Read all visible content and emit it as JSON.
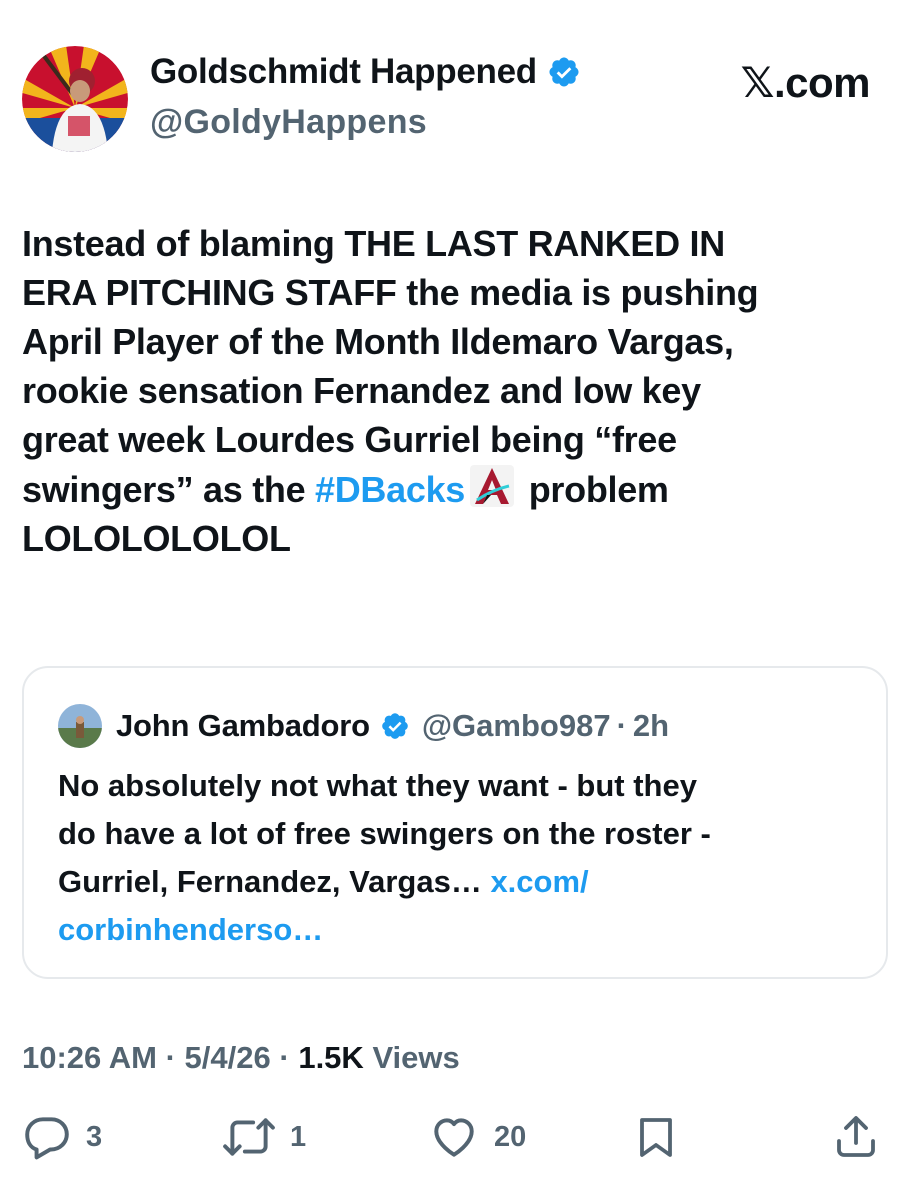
{
  "author": {
    "display_name": "Goldschmidt Happened",
    "handle": "@GoldyHappens",
    "verified": true
  },
  "brand": "𝕏.com",
  "tweet": {
    "lines": [
      "Instead of blaming THE LAST RANKED IN",
      "ERA PITCHING STAFF the media is pushing",
      "April Player of the Month Ildemaro Vargas,",
      "rookie sensation Fernandez and low key",
      "great week Lourdes Gurriel being “free"
    ],
    "line6_before": "swingers” as the ",
    "hashtag": "#DBacks",
    "line6_after": " problem",
    "line7": "LOLOLOLOLOL"
  },
  "quote": {
    "name": "John Gambadoro",
    "handle": "@Gambo987",
    "separator": "·",
    "time": "2h",
    "lines": [
      "No absolutely not what they want - but they",
      "do have a lot of free swingers on the roster -"
    ],
    "line3_text": "Gurriel, Fernandez, Vargas… ",
    "link_part1": "x.com/",
    "link_part2": "corbinhenderso…"
  },
  "meta": {
    "time": "10:26 AM",
    "sep": "·",
    "date": "5/4/26",
    "views_count": "1.5K",
    "views_label": "Views"
  },
  "actions": {
    "replies": "3",
    "reposts": "1",
    "likes": "20"
  },
  "colors": {
    "accent": "#1d9bf0",
    "text": "#0f1419",
    "muted": "#536471",
    "border": "#e6e9ec"
  }
}
